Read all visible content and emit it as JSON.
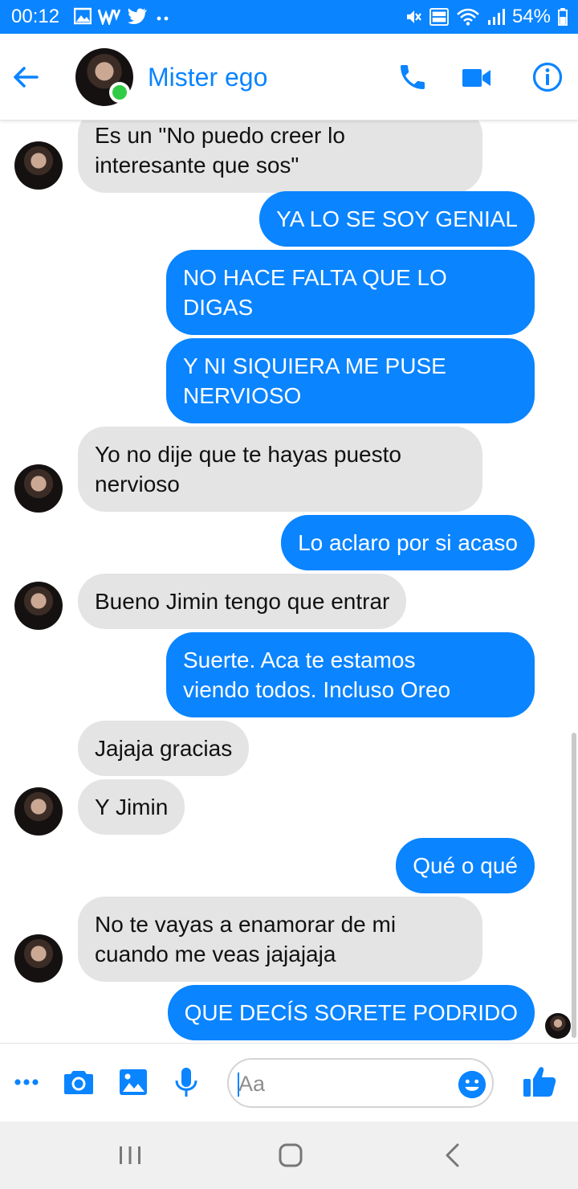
{
  "status_bar": {
    "time": "00:12",
    "battery": "54%"
  },
  "header": {
    "contact_name": "Mister ego"
  },
  "messages": [
    {
      "text": "Es un \"No puedo creer lo\ninteresante que sos\""
    },
    {
      "text": "YA LO SE SOY GENIAL"
    },
    {
      "text": "NO HACE FALTA QUE LO\nDIGAS"
    },
    {
      "text": "Y NI SIQUIERA ME PUSE\nNERVIOSO"
    },
    {
      "text": "Yo no dije que te hayas puesto\nnervioso"
    },
    {
      "text": "Lo aclaro por si acaso"
    },
    {
      "text": "Bueno Jimin tengo que entrar"
    },
    {
      "text": "Suerte. Aca te estamos\nviendo todos. Incluso Oreo"
    },
    {
      "text": "Jajaja gracias"
    },
    {
      "text": "Y Jimin"
    },
    {
      "text": "Qué o qué"
    },
    {
      "text": "No te vayas a enamorar de mi\ncuando me veas jajajaja"
    },
    {
      "text": "QUE DECÍS SORETE PODRIDO"
    }
  ],
  "composer": {
    "placeholder": "Aa"
  },
  "colors": {
    "accent": "#0a84ff",
    "online": "#31cc46",
    "incoming_bubble": "#e4e4e4"
  },
  "icons": [
    "back-arrow-icon",
    "phone-icon",
    "video-camera-icon",
    "info-icon",
    "more-icon",
    "camera-icon",
    "image-icon",
    "microphone-icon",
    "emoji-icon",
    "thumbs-up-icon",
    "recents-icon",
    "home-icon",
    "back-icon"
  ]
}
